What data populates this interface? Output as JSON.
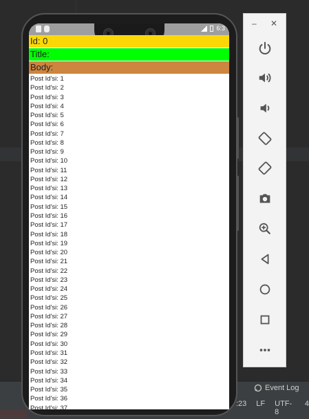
{
  "app": {
    "fields": {
      "id_label": "Id: 0",
      "title_label": "Title:",
      "body_label": "Body:"
    },
    "posts": [
      "Post Id'si: 1",
      "Post Id'si: 2",
      "Post Id'si: 3",
      "Post Id'si: 4",
      "Post Id'si: 5",
      "Post Id'si: 6",
      "Post Id'si: 7",
      "Post Id'si: 8",
      "Post Id'si: 9",
      "Post Id'si: 10",
      "Post Id'si: 11",
      "Post Id'si: 12",
      "Post Id'si: 13",
      "Post Id'si: 14",
      "Post Id'si: 15",
      "Post Id'si: 16",
      "Post Id'si: 17",
      "Post Id'si: 18",
      "Post Id'si: 19",
      "Post Id'si: 20",
      "Post Id'si: 21",
      "Post Id'si: 22",
      "Post Id'si: 23",
      "Post Id'si: 24",
      "Post Id'si: 25",
      "Post Id'si: 26",
      "Post Id'si: 27",
      "Post Id'si: 28",
      "Post Id'si: 29",
      "Post Id'si: 30",
      "Post Id'si: 31",
      "Post Id'si: 32",
      "Post Id'si: 33",
      "Post Id'si: 34",
      "Post Id'si: 35",
      "Post Id'si: 36",
      "Post Id'si: 37"
    ]
  },
  "phone_status": {
    "time": "6:3"
  },
  "emulator": {
    "minimize": "–",
    "close": "✕",
    "buttons": [
      "power-icon",
      "volume-up-icon",
      "volume-down-icon",
      "rotate-left-icon",
      "rotate-right-icon",
      "camera-icon",
      "zoom-icon",
      "back-icon",
      "home-icon",
      "overview-icon",
      "more-icon"
    ]
  },
  "ide_status": {
    "event_log": "Event Log",
    "position": ":23",
    "line_sep": "LF",
    "encoding": "UTF-8",
    "indent": "4"
  },
  "colors": {
    "id_bg": "#fcd708",
    "title_bg": "#00ff00",
    "body_bg": "#cd853f"
  }
}
